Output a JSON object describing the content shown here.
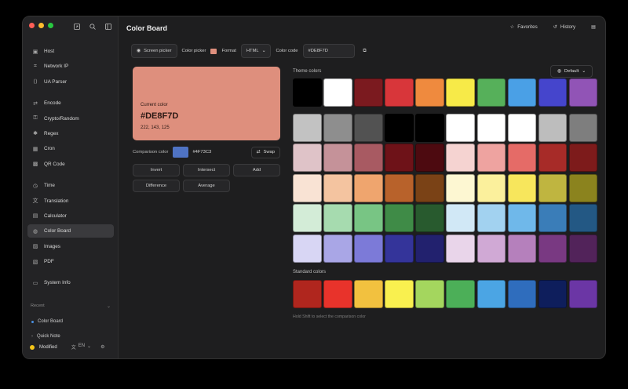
{
  "sidebar": {
    "nav_groups": [
      [
        {
          "label": "Host",
          "icon": "host-icon"
        },
        {
          "label": "Network IP",
          "icon": "network-icon"
        },
        {
          "label": "UA Parser",
          "icon": "ua-icon"
        }
      ],
      [
        {
          "label": "Encode",
          "icon": "encode-icon"
        },
        {
          "label": "Crypto/Random",
          "icon": "crypto-icon"
        },
        {
          "label": "Regex",
          "icon": "regex-icon"
        },
        {
          "label": "Cron",
          "icon": "cron-icon"
        },
        {
          "label": "QR Code",
          "icon": "qr-icon"
        }
      ],
      [
        {
          "label": "Time",
          "icon": "clock-icon"
        },
        {
          "label": "Translation",
          "icon": "translate-icon"
        },
        {
          "label": "Calculator",
          "icon": "calculator-icon"
        },
        {
          "label": "Color Board",
          "icon": "palette-icon",
          "active": true
        },
        {
          "label": "Images",
          "icon": "image-icon"
        },
        {
          "label": "PDF",
          "icon": "pdf-icon"
        }
      ],
      [
        {
          "label": "System Info",
          "icon": "system-icon"
        }
      ]
    ],
    "recent_label": "Recent",
    "recent_items": [
      "Color Board",
      "Quick Note"
    ],
    "theme_label": "Modified",
    "lang": "EN"
  },
  "header": {
    "title": "Color Board",
    "favorites": "Favorites",
    "history": "History"
  },
  "toolbar": {
    "screen_picker": "Screen picker",
    "color_picker": "Color picker",
    "format_label": "Format",
    "format_value": "HTML",
    "color_code_label": "Color code",
    "color_code_value": "#DE8F7D"
  },
  "current": {
    "label": "Current color",
    "hex": "#DE8F7D",
    "rgb": "222, 143, 125",
    "color": "#DE8F7D"
  },
  "comparison": {
    "label": "Comparison color",
    "hex": "#4F73C3",
    "color": "#4F73C3",
    "swap": "Swap"
  },
  "ops": [
    "Invert",
    "Intersect",
    "Add",
    "Difference",
    "Average"
  ],
  "theme": {
    "label": "Theme colors",
    "default_btn": "Default",
    "colors": [
      "#000000",
      "#FFFFFF",
      "#7B1A1F",
      "#D8363A",
      "#EF8A3E",
      "#F7EA48",
      "#56B05A",
      "#4AA0E6",
      "#4545CC",
      "#9154B6",
      "#C2C2C2",
      "#8E8E8E",
      "#525252",
      "#000000",
      "#000000",
      "#FFFFFF",
      "#FFFFFF",
      "#FFFFFF",
      "#BDBDBD",
      "#7E7E7E",
      "#DFC3C8",
      "#C59299",
      "#A85A62",
      "#6E1218",
      "#4D0A10",
      "#F5D3D1",
      "#EEA3A0",
      "#E56B67",
      "#A72B28",
      "#7D1B1B",
      "#F9E3D4",
      "#F4C4A0",
      "#EFA56E",
      "#B8622B",
      "#7A4216",
      "#FDF7D2",
      "#FBF09C",
      "#F7E65C",
      "#BFB540",
      "#8B831E",
      "#D3ECD7",
      "#A6DBAF",
      "#78C584",
      "#3F8B47",
      "#285A2E",
      "#D1E8F6",
      "#A2D2F0",
      "#6FB8EA",
      "#3A7DB8",
      "#235884",
      "#D8D6F4",
      "#A9A6E6",
      "#7C7AD8",
      "#34349A",
      "#22216E",
      "#E9D5EA",
      "#D0A9D5",
      "#B580BC",
      "#793982",
      "#52235A"
    ]
  },
  "standard": {
    "label": "Standard colors",
    "colors": [
      "#B0261E",
      "#E8332B",
      "#F2C13F",
      "#F9F04F",
      "#A4D65E",
      "#4CAF58",
      "#4BA5E4",
      "#2F6DBD",
      "#0E1E5C",
      "#6B36A5"
    ]
  },
  "hint": "Hold Shift to select the comparison color"
}
